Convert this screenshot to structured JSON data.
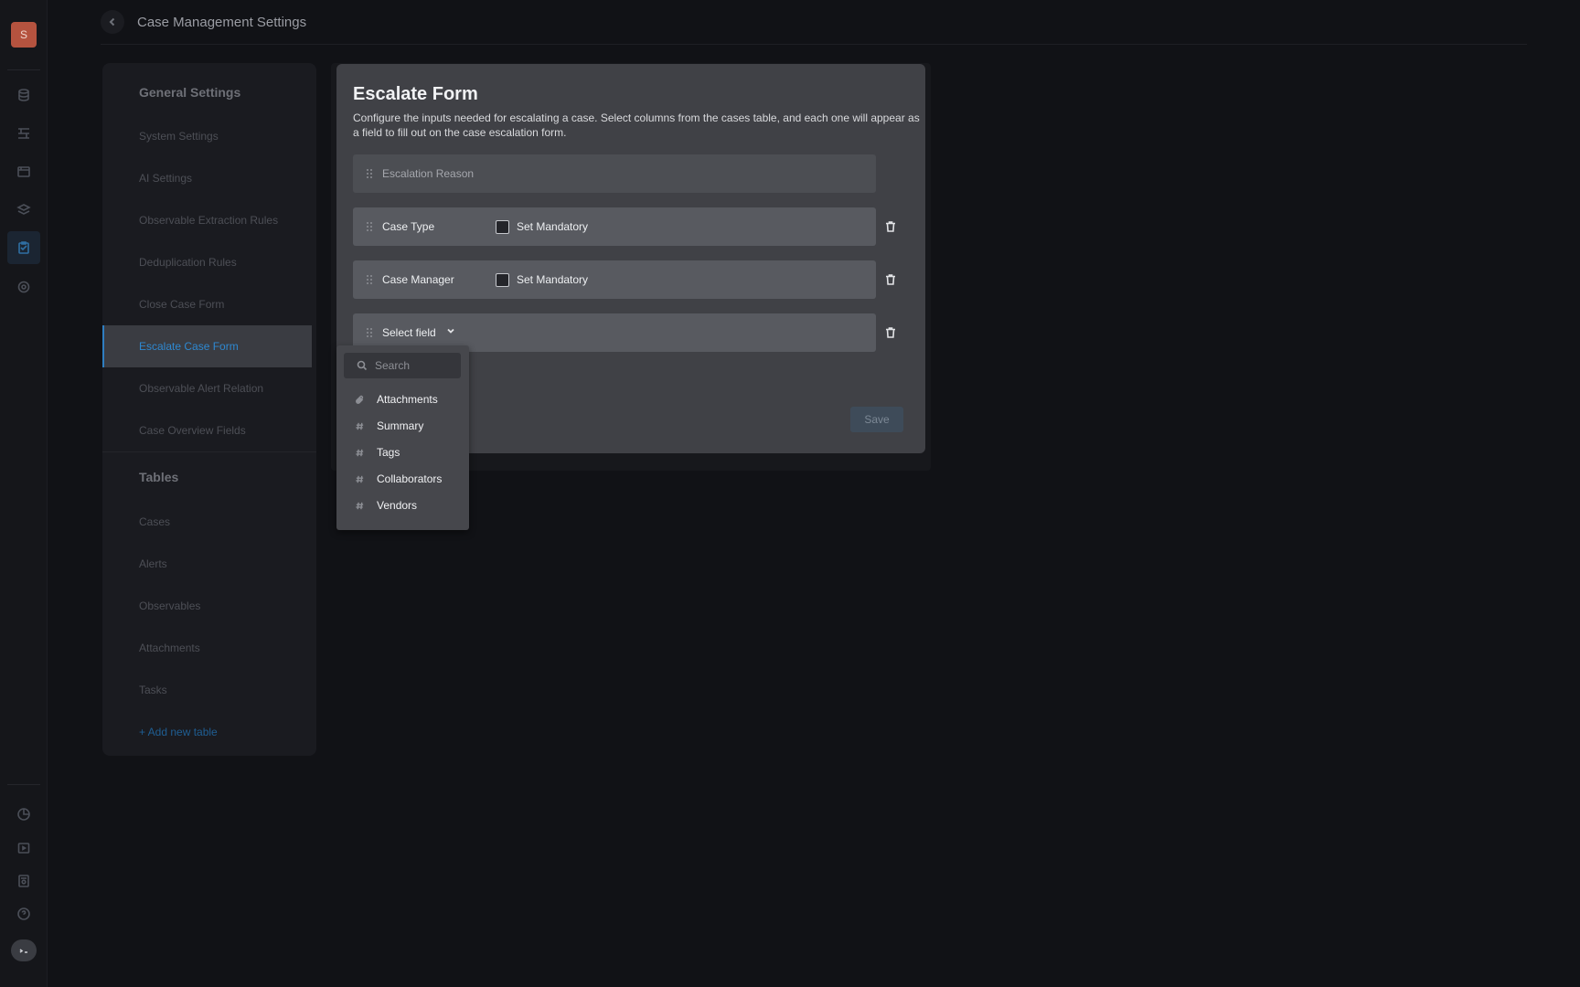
{
  "app": {
    "logo_letter": "S",
    "page_title": "Case Management Settings"
  },
  "nav": {
    "general_title": "General Settings",
    "general_items": [
      {
        "label": "System Settings"
      },
      {
        "label": "AI Settings"
      },
      {
        "label": "Observable Extraction Rules"
      },
      {
        "label": "Deduplication Rules"
      },
      {
        "label": "Close Case Form"
      },
      {
        "label": "Escalate Case Form",
        "active": true
      },
      {
        "label": "Observable Alert Relation"
      },
      {
        "label": "Case Overview Fields"
      }
    ],
    "tables_title": "Tables",
    "table_items": [
      {
        "label": "Cases"
      },
      {
        "label": "Alerts"
      },
      {
        "label": "Observables"
      },
      {
        "label": "Attachments"
      },
      {
        "label": "Tasks"
      }
    ],
    "add_table_label": "+ Add new table"
  },
  "form": {
    "title": "Escalate Form",
    "description": "Configure the inputs needed for escalating a case. Select columns from the cases table, and each one will appear as a field to fill out on the case escalation form.",
    "fixed_field": "Escalation Reason",
    "fields": [
      {
        "label": "Case Type",
        "mandatory_label": "Set Mandatory",
        "mandatory": false
      },
      {
        "label": "Case Manager",
        "mandatory_label": "Set Mandatory",
        "mandatory": false
      }
    ],
    "select_field_label": "Select field",
    "save_label": "Save"
  },
  "dropdown": {
    "search_placeholder": "Search",
    "options": [
      {
        "label": "Attachments",
        "icon": "paperclip-icon"
      },
      {
        "label": "Summary",
        "icon": "hash-icon"
      },
      {
        "label": "Tags",
        "icon": "hash-icon"
      },
      {
        "label": "Collaborators",
        "icon": "hash-icon"
      },
      {
        "label": "Vendors",
        "icon": "hash-icon"
      }
    ]
  },
  "colors": {
    "accent": "#2e88d0",
    "logo_bg": "#b5533f",
    "background": "#111216"
  }
}
